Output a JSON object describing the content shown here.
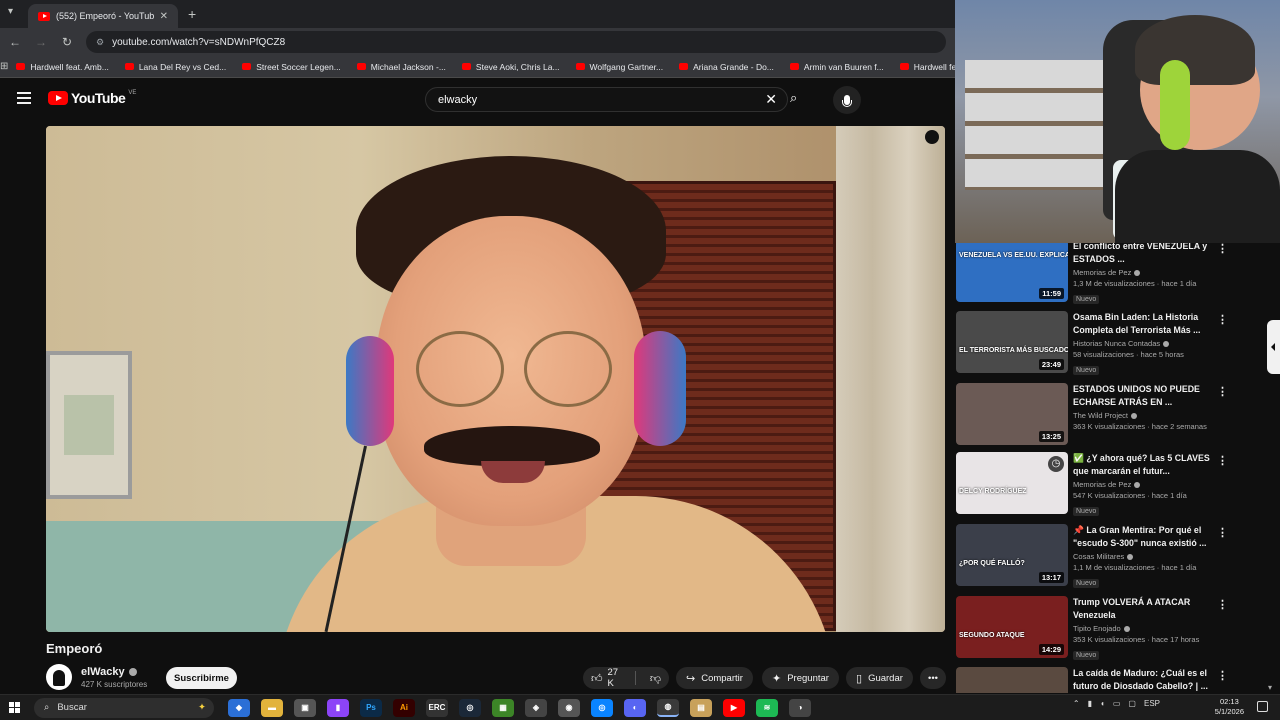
{
  "browser": {
    "tab_title": "(552) Empeoró - YouTube",
    "url": "youtube.com/watch?v=sNDWnPfQCZ8",
    "bookmarks": [
      "Hardwell feat. Amb...",
      "Lana Del Rey vs Ced...",
      "Street Soccer Legen...",
      "Michael Jackson -...",
      "Steve Aoki, Chris La...",
      "Wolfgang Gartner...",
      "Ariana Grande - Do...",
      "Armin van Buuren f...",
      "Hardwell feat. Matt..."
    ]
  },
  "youtube": {
    "logo_text": "YouTube",
    "logo_region": "VE",
    "search_value": "elwacky"
  },
  "video": {
    "title": "Empeoró",
    "channel": "elWacky",
    "subscribers": "427 K suscriptores",
    "subscribe_label": "Suscribirme",
    "likes": "27 K",
    "share_label": "Compartir",
    "ask_label": "Preguntar",
    "save_label": "Guardar"
  },
  "recommendations": [
    {
      "title": "El conflicto entre VENEZUELA y ESTADOS ...",
      "channel": "Memorias de Pez",
      "views": "1,3 M de visualizaciones · hace 1 día",
      "badge": "Nuevo",
      "duration": "11:59",
      "thumb_caption": "VENEZUELA VS EE.UU. EXPLICADO",
      "thumb_color": "#2f6fc2"
    },
    {
      "title": "Osama Bin Laden: La Historia Completa del Terrorista Más ...",
      "channel": "Historias Nunca Contadas",
      "views": "58 visualizaciones · hace 5 horas",
      "badge": "Nuevo",
      "duration": "23:49",
      "thumb_caption": "EL TERRORISTA MÁS BUSCADO",
      "thumb_color": "#4a4a4a"
    },
    {
      "title": "ESTADOS UNIDOS NO PUEDE ECHARSE ATRÁS EN ...",
      "channel": "The Wild Project",
      "views": "363 K visualizaciones · hace 2 semanas",
      "badge": "",
      "duration": "13:25",
      "thumb_caption": "",
      "thumb_color": "#6b5a55"
    },
    {
      "title": "✅ ¿Y ahora qué? Las 5 CLAVES que marcarán el futur...",
      "channel": "Memorias de Pez",
      "views": "547 K visualizaciones · hace 1 día",
      "badge": "Nuevo",
      "duration": "",
      "thumb_caption": "DELCY RODRÍGUEZ",
      "thumb_color": "#e8e4e6"
    },
    {
      "title": "📌 La Gran Mentira: Por qué el \"escudo S-300\" nunca existió ...",
      "channel": "Cosas Militares",
      "views": "1,1 M de visualizaciones · hace 1 día",
      "badge": "Nuevo",
      "duration": "13:17",
      "thumb_caption": "¿POR QUÉ FALLÓ?",
      "thumb_color": "#3b3f4a"
    },
    {
      "title": "Trump VOLVERÁ A ATACAR Venezuela",
      "channel": "Tipito Enojado",
      "views": "353 K visualizaciones · hace 17 horas",
      "badge": "Nuevo",
      "duration": "14:29",
      "thumb_caption": "SEGUNDO ATAQUE",
      "thumb_color": "#7a1f1f"
    },
    {
      "title": "La caída de Maduro: ¿Cuál es el futuro de Diosdado Cabello? | ...",
      "channel": "",
      "views": "",
      "badge": "",
      "duration": "",
      "thumb_caption": "",
      "thumb_color": "#5a4a40"
    }
  ],
  "taskbar": {
    "search_label": "Buscar",
    "lang": "ESP",
    "time": "02:13",
    "date": "5/1/2026"
  }
}
